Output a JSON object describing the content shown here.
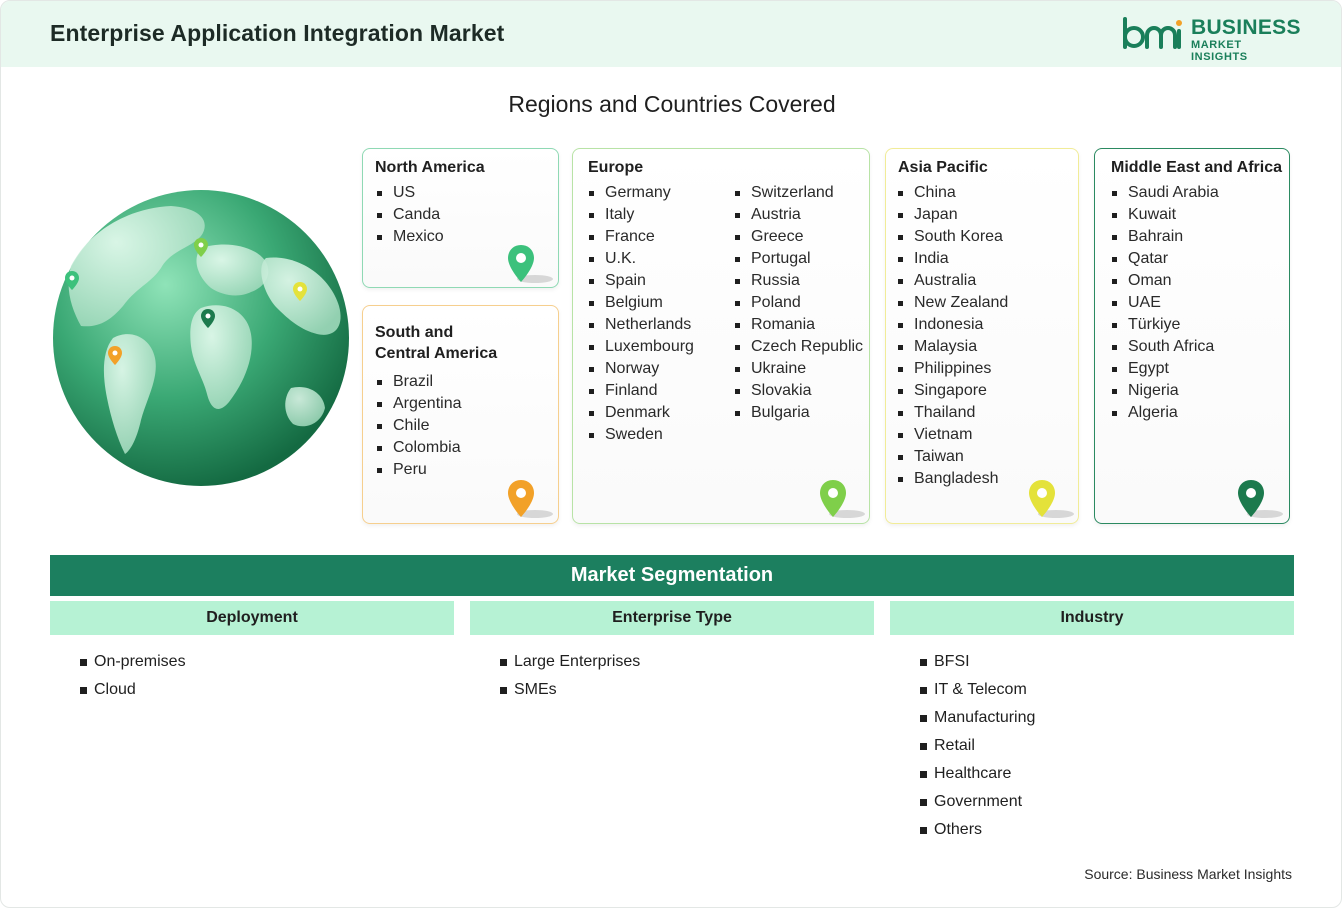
{
  "header": {
    "title": "Enterprise Application Integration Market",
    "logo": {
      "word1": "BUSINESS",
      "word2": "MARKET INSIGHTS",
      "mark": "bmi"
    }
  },
  "regions": {
    "title": "Regions and Countries Covered",
    "north_america": {
      "title": "North America",
      "items": [
        "US",
        "Canda",
        "Mexico"
      ],
      "pin_color": "#3cc17c"
    },
    "south_america": {
      "title_line1": "South and",
      "title_line2": "Central America",
      "items": [
        "Brazil",
        "Argentina",
        "Chile",
        "Colombia",
        "Peru"
      ],
      "pin_color": "#f2a128"
    },
    "europe": {
      "title": "Europe",
      "col1": [
        "Germany",
        "Italy",
        "France",
        "U.K.",
        "Spain",
        "Belgium",
        "Netherlands",
        "Luxembourg",
        "Norway",
        "Finland",
        "Denmark",
        "Sweden"
      ],
      "col2": [
        "Switzerland",
        "Austria",
        "Greece",
        "Portugal",
        "Russia",
        "Poland",
        "Romania",
        "Czech Republic",
        "Ukraine",
        "Slovakia",
        "Bulgaria"
      ],
      "pin_color": "#7fcf4a"
    },
    "asia_pacific": {
      "title": "Asia Pacific",
      "items": [
        "China",
        "Japan",
        "South Korea",
        "India",
        "Australia",
        "New Zealand",
        "Indonesia",
        "Malaysia",
        "Philippines",
        "Singapore",
        "Thailand",
        "Vietnam",
        "Taiwan",
        "Bangladesh"
      ],
      "pin_color": "#e4e23a"
    },
    "middle_east_africa": {
      "title": "Middle East and Africa",
      "items": [
        "Saudi Arabia",
        "Kuwait",
        "Bahrain",
        "Qatar",
        "Oman",
        "UAE",
        "Türkiye",
        "South Africa",
        "Egypt",
        "Nigeria",
        "Algeria"
      ],
      "pin_color": "#1c7a4d"
    }
  },
  "segmentation": {
    "title": "Market Segmentation",
    "columns": [
      {
        "heading": "Deployment",
        "items": [
          "On-premises",
          "Cloud"
        ]
      },
      {
        "heading": "Enterprise Type",
        "items": [
          "Large Enterprises",
          "SMEs"
        ]
      },
      {
        "heading": "Industry",
        "items": [
          "BFSI",
          "IT & Telecom",
          "Manufacturing",
          "Retail",
          "Healthcare",
          "Government",
          "Others"
        ]
      }
    ]
  },
  "source": "Source: Business Market Insights",
  "colors": {
    "accent": "#1c7f5f",
    "header_bg": "#e9f8f0",
    "subheader_bg": "#b6f2d4"
  }
}
